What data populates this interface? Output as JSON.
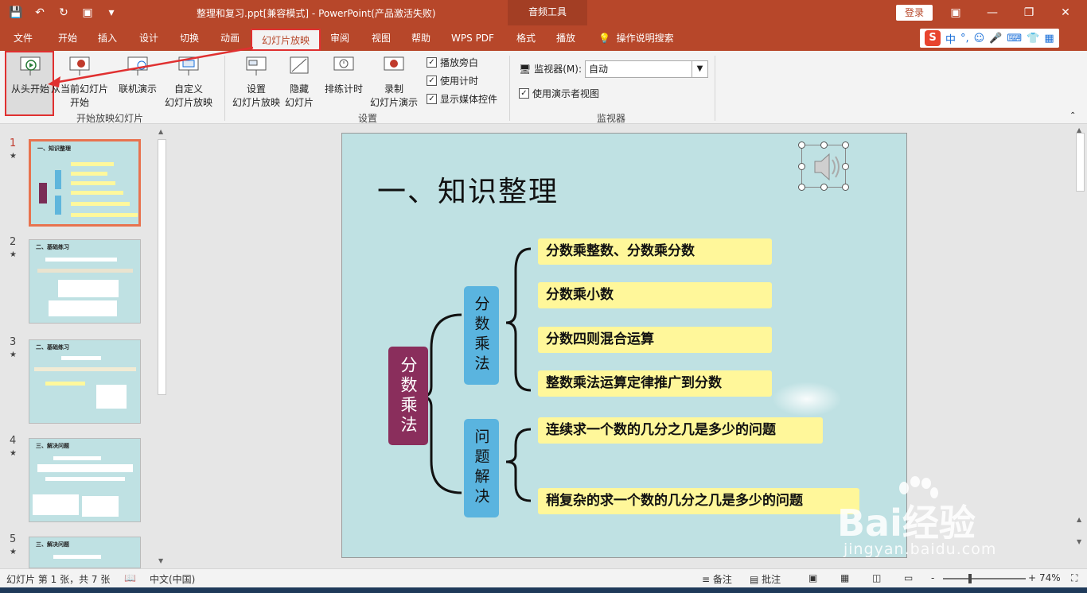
{
  "window": {
    "title": "整理和复习.ppt[兼容模式]  -  PowerPoint(产品激活失败)",
    "context_tab": "音频工具",
    "login": "登录"
  },
  "tabs": [
    "文件",
    "开始",
    "插入",
    "设计",
    "切换",
    "动画",
    "幻灯片放映",
    "审阅",
    "视图",
    "帮助",
    "WPS PDF",
    "格式",
    "播放"
  ],
  "active_tab": "幻灯片放映",
  "tell_me": "操作说明搜索",
  "ime": {
    "logo": "S",
    "lang": "中"
  },
  "ribbon": {
    "start_group": {
      "from_start": "从头开始",
      "from_current_l1": "从当前幻灯片",
      "from_current_l2": "开始",
      "online": "联机演示",
      "custom_l1": "自定义",
      "custom_l2": "幻灯片放映",
      "label": "开始放映幻灯片"
    },
    "setup_group": {
      "setup_l1": "设置",
      "setup_l2": "幻灯片放映",
      "hide_l1": "隐藏",
      "hide_l2": "幻灯片",
      "rehearse": "排练计时",
      "record_l1": "录制",
      "record_l2": "幻灯片演示",
      "chk_narration": "播放旁白",
      "chk_timing": "使用计时",
      "chk_media": "显示媒体控件",
      "label": "设置"
    },
    "monitor_group": {
      "monitor_label": "监视器(M):",
      "monitor_value": "自动",
      "presenter_view": "使用演示者视图",
      "label": "监视器"
    }
  },
  "thumbnails": [
    {
      "num": "1",
      "title": "一、知识整理",
      "selected": true
    },
    {
      "num": "2",
      "title": "二、基础练习",
      "selected": false
    },
    {
      "num": "3",
      "title": "二、基础练习",
      "selected": false
    },
    {
      "num": "4",
      "title": "三、解决问题",
      "selected": false
    },
    {
      "num": "5",
      "title": "三、解决问题",
      "selected": false
    }
  ],
  "slide": {
    "title": "一、知识整理",
    "root": "分数乘法",
    "branches": [
      {
        "label": "分数乘法",
        "items": [
          "分数乘整数、分数乘分数",
          "分数乘小数",
          "分数四则混合运算",
          "整数乘法运算定律推广到分数"
        ]
      },
      {
        "label": "问题解决",
        "items": [
          "连续求一个数的几分之几是多少的问题",
          "稍复杂的求一个数的几分之几是多少的问题"
        ]
      }
    ]
  },
  "status": {
    "slide_info": "幻灯片 第 1 张，共 7 张",
    "language": "中文(中国)",
    "notes": "备注",
    "comments": "批注",
    "zoom": "74%",
    "zoom_minus": "-",
    "zoom_plus": "+"
  },
  "watermark": {
    "brand": "Bai经验",
    "url": "jingyan.baidu.com"
  },
  "colors": {
    "accent": "#b7472a",
    "highlight": "#e03030",
    "slide_bg": "#bfe1e3",
    "leaf": "#fff79a",
    "root": "#8a2e5c",
    "branch": "#5ab4df"
  }
}
